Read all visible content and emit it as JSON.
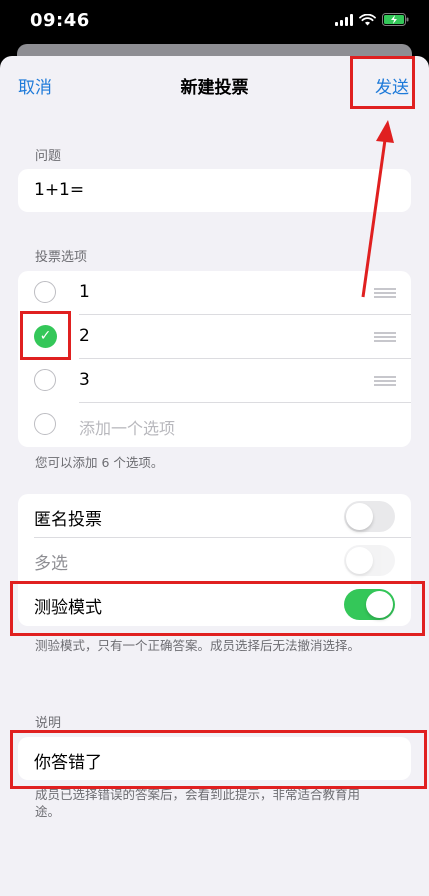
{
  "status_bar": {
    "time": "09:46"
  },
  "nav": {
    "cancel": "取消",
    "title": "新建投票",
    "send": "发送"
  },
  "question": {
    "label": "问题",
    "value": "1+1="
  },
  "options": {
    "label": "投票选项",
    "items": [
      {
        "text": "1",
        "checked": false
      },
      {
        "text": "2",
        "checked": true
      },
      {
        "text": "3",
        "checked": false
      }
    ],
    "add_placeholder": "添加一个选项",
    "footer": "您可以添加 6 个选项。"
  },
  "settings": {
    "anonymous": {
      "label": "匿名投票",
      "on": false
    },
    "multiple": {
      "label": "多选",
      "on": false,
      "disabled": true
    },
    "quiz": {
      "label": "测验模式",
      "on": true
    },
    "footer": "测验模式，只有一个正确答案。成员选择后无法撤消选择。"
  },
  "explanation": {
    "label": "说明",
    "value": "你答错了",
    "footer": "成员已选择错误的答案后，会看到此提示，非常适合教育用途。"
  },
  "colors": {
    "accent": "#1e7ad9",
    "toggle_on": "#34c759",
    "annotation": "#e02020"
  }
}
